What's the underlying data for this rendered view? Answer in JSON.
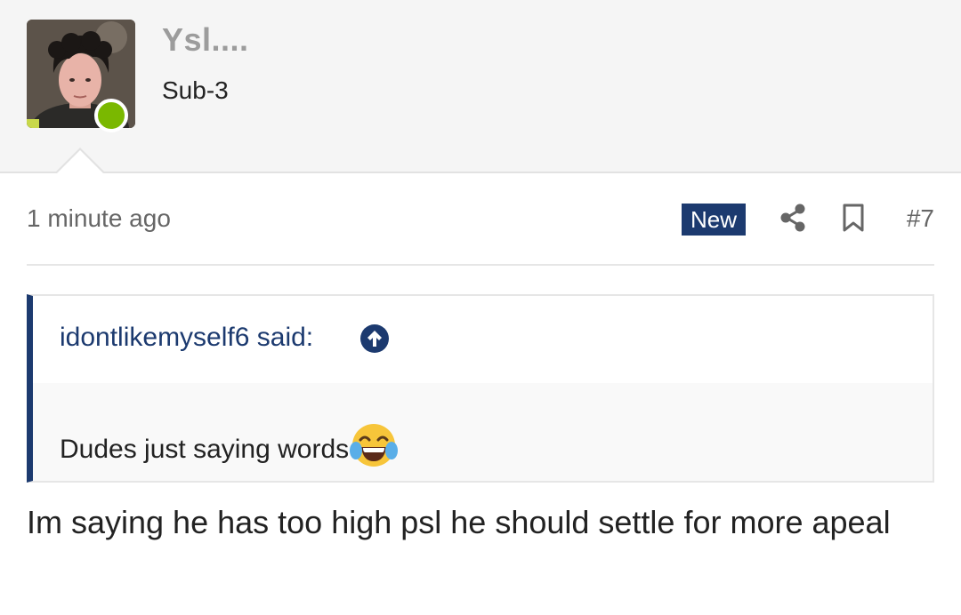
{
  "user": {
    "name": "Ysl....",
    "title": "Sub-3",
    "online_color": "#7ab800"
  },
  "post": {
    "timestamp": "1 minute ago",
    "badge": "New",
    "number": "#7",
    "body": "Im saying he has too high psl he should settle for more apeal"
  },
  "quote": {
    "author": "idontlikemyself6 said:",
    "text": "Dudes just saying words",
    "emoji": "face-with-tears-of-joy-icon"
  },
  "icons": {
    "share": "share-icon",
    "bookmark": "bookmark-icon",
    "jump": "arrow-up-circle-icon"
  },
  "colors": {
    "accent": "#1c3a6f",
    "header_bg": "#f5f5f5"
  }
}
